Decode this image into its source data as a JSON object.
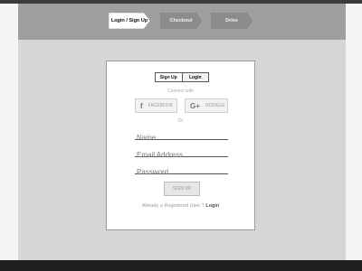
{
  "steps": [
    {
      "label": "Login / Sign Up"
    },
    {
      "label": "Checkout"
    },
    {
      "label": "Drive"
    }
  ],
  "tabs": {
    "signup": "Sign Up",
    "login": "Login"
  },
  "connect_with": "Connect with",
  "social": {
    "facebook": "FACEBOOK",
    "google": "GOOGLE",
    "facebook_icon": "f",
    "google_icon": "G+"
  },
  "or_label": "Or",
  "fields": {
    "name_placeholder": "Name",
    "email_placeholder": "Email Address",
    "password_placeholder": "Password"
  },
  "signup_button": "SIGN UP",
  "registered": {
    "text": "Already a Registered User ?",
    "link": "Login"
  },
  "colors": {
    "header": "#9e9e9e",
    "active_step": "#ffffff",
    "inactive_step": "#8c8c8c",
    "footer": "#1f1f1f"
  }
}
